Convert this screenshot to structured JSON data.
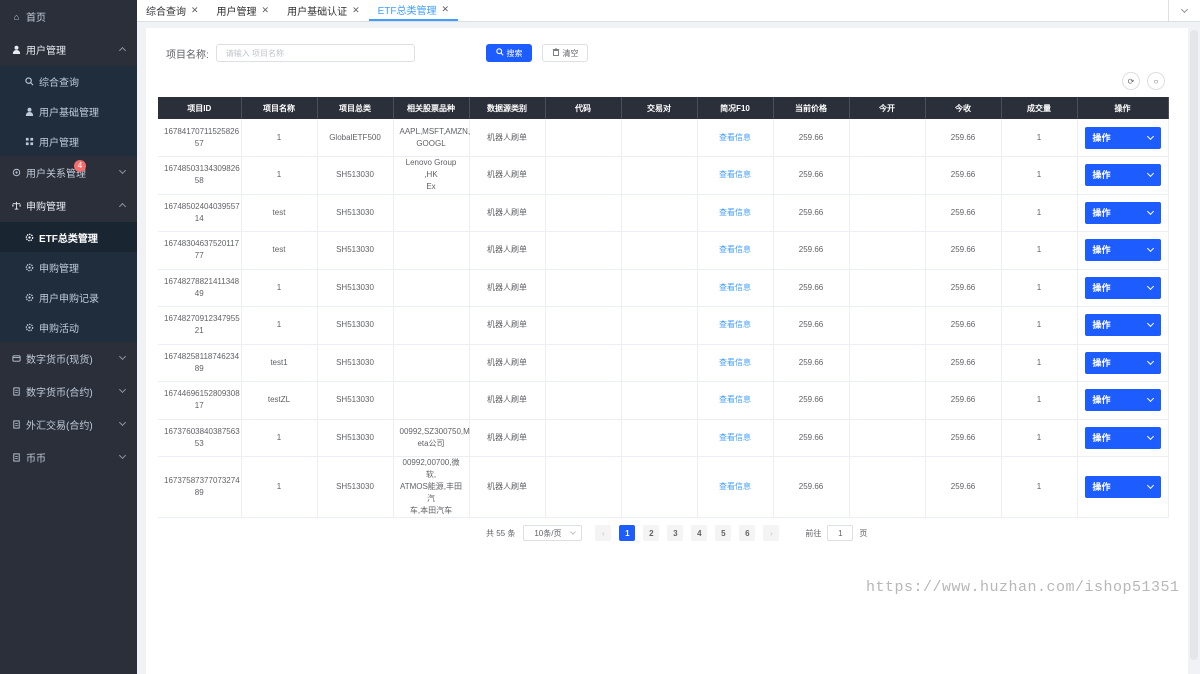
{
  "sidebar": {
    "home": "首页",
    "user_mgmt": "用户管理",
    "user_mgmt_children": [
      "综合查询",
      "用户基础管理",
      "用户管理"
    ],
    "user_relation": "用户关系管理",
    "user_relation_badge": "4",
    "subscribe_mgmt": "申购管理",
    "subscribe_children": [
      "ETF总类管理",
      "申购管理",
      "用户申购记录",
      "申购活动"
    ],
    "digital_spot": "数字货币(现货)",
    "digital_contract": "数字货币(合约)",
    "forex": "外汇交易(合约)",
    "coin": "币币"
  },
  "tabs": [
    {
      "label": "综合查询",
      "active": false
    },
    {
      "label": "用户管理",
      "active": false
    },
    {
      "label": "用户基础认证",
      "active": false
    },
    {
      "label": "ETF总类管理",
      "active": true
    }
  ],
  "search": {
    "label": "项目名称:",
    "placeholder": "请输入 项目名称",
    "search_btn": "搜索",
    "clear_btn": "清空"
  },
  "table": {
    "headers": [
      "项目ID",
      "项目名称",
      "项目总类",
      "相关股票品种",
      "数据源类别",
      "代码",
      "交易对",
      "简况F10",
      "当前价格",
      "今开",
      "今收",
      "成交量",
      "操作"
    ],
    "rows": [
      {
        "id": "16784170711525826\n57",
        "name": "1",
        "type": "GlobalETF500",
        "stocks": "AAPL,MSFT,AMZN,\nGOOGL",
        "source": "机器人刷单",
        "code": "",
        "pair": "",
        "f10": "查看信息",
        "price": "259.66",
        "open": "",
        "close": "259.66",
        "volume": "1",
        "op": "操作"
      },
      {
        "id": "16748503134309826\n58",
        "name": "1",
        "type": "SH513030",
        "stocks": "Lenovo Group ,HK\nEx",
        "source": "机器人刷单",
        "code": "",
        "pair": "",
        "f10": "查看信息",
        "price": "259.66",
        "open": "",
        "close": "259.66",
        "volume": "1",
        "op": "操作"
      },
      {
        "id": "16748502404039557\n14",
        "name": "test",
        "type": "SH513030",
        "stocks": "",
        "source": "机器人刷单",
        "code": "",
        "pair": "",
        "f10": "查看信息",
        "price": "259.66",
        "open": "",
        "close": "259.66",
        "volume": "1",
        "op": "操作"
      },
      {
        "id": "16748304637520117\n77",
        "name": "test",
        "type": "SH513030",
        "stocks": "",
        "source": "机器人刷单",
        "code": "",
        "pair": "",
        "f10": "查看信息",
        "price": "259.66",
        "open": "",
        "close": "259.66",
        "volume": "1",
        "op": "操作"
      },
      {
        "id": "16748278821411348\n49",
        "name": "1",
        "type": "SH513030",
        "stocks": "",
        "source": "机器人刷单",
        "code": "",
        "pair": "",
        "f10": "查看信息",
        "price": "259.66",
        "open": "",
        "close": "259.66",
        "volume": "1",
        "op": "操作"
      },
      {
        "id": "16748270912347955\n21",
        "name": "1",
        "type": "SH513030",
        "stocks": "",
        "source": "机器人刷单",
        "code": "",
        "pair": "",
        "f10": "查看信息",
        "price": "259.66",
        "open": "",
        "close": "259.66",
        "volume": "1",
        "op": "操作"
      },
      {
        "id": "16748258118746234\n89",
        "name": "test1",
        "type": "SH513030",
        "stocks": "",
        "source": "机器人刷单",
        "code": "",
        "pair": "",
        "f10": "查看信息",
        "price": "259.66",
        "open": "",
        "close": "259.66",
        "volume": "1",
        "op": "操作"
      },
      {
        "id": "16744696152809308\n17",
        "name": "testZL",
        "type": "SH513030",
        "stocks": "",
        "source": "机器人刷单",
        "code": "",
        "pair": "",
        "f10": "查看信息",
        "price": "259.66",
        "open": "",
        "close": "259.66",
        "volume": "1",
        "op": "操作"
      },
      {
        "id": "16737603840387563\n53",
        "name": "1",
        "type": "SH513030",
        "stocks": "00992,SZ300750,M\neta公司",
        "source": "机器人刷单",
        "code": "",
        "pair": "",
        "f10": "查看信息",
        "price": "259.66",
        "open": "",
        "close": "259.66",
        "volume": "1",
        "op": "操作"
      },
      {
        "id": "16737587377073274\n89",
        "name": "1",
        "type": "SH513030",
        "stocks": "00992,00700,微软,\nATMOS能源,丰田汽\n车,本田汽车",
        "source": "机器人刷单",
        "code": "",
        "pair": "",
        "f10": "查看信息",
        "price": "259.66",
        "open": "",
        "close": "259.66",
        "volume": "1",
        "op": "操作"
      }
    ]
  },
  "pagination": {
    "total": "共 55 条",
    "page_size": "10条/页",
    "pages": [
      "1",
      "2",
      "3",
      "4",
      "5",
      "6"
    ],
    "current": "1",
    "goto_label": "前往",
    "goto_value": "1",
    "goto_suffix": "页"
  },
  "watermark": "https://www.huzhan.com/ishop51351",
  "colors": {
    "sidebar_bg": "#2b2f3a",
    "primary": "#1d5cff",
    "link": "#409eff",
    "table_header_bg": "#2b2f3a"
  }
}
